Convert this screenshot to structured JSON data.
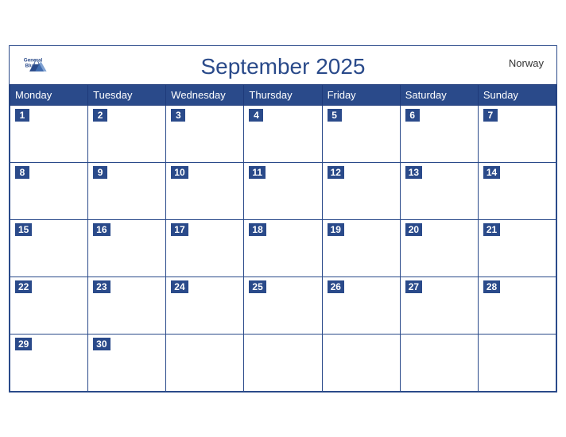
{
  "header": {
    "title": "September 2025",
    "country": "Norway",
    "logo_general": "General",
    "logo_blue": "Blue"
  },
  "weekdays": [
    "Monday",
    "Tuesday",
    "Wednesday",
    "Thursday",
    "Friday",
    "Saturday",
    "Sunday"
  ],
  "weeks": [
    [
      1,
      2,
      3,
      4,
      5,
      6,
      7
    ],
    [
      8,
      9,
      10,
      11,
      12,
      13,
      14
    ],
    [
      15,
      16,
      17,
      18,
      19,
      20,
      21
    ],
    [
      22,
      23,
      24,
      25,
      26,
      27,
      28
    ],
    [
      29,
      30,
      null,
      null,
      null,
      null,
      null
    ]
  ]
}
